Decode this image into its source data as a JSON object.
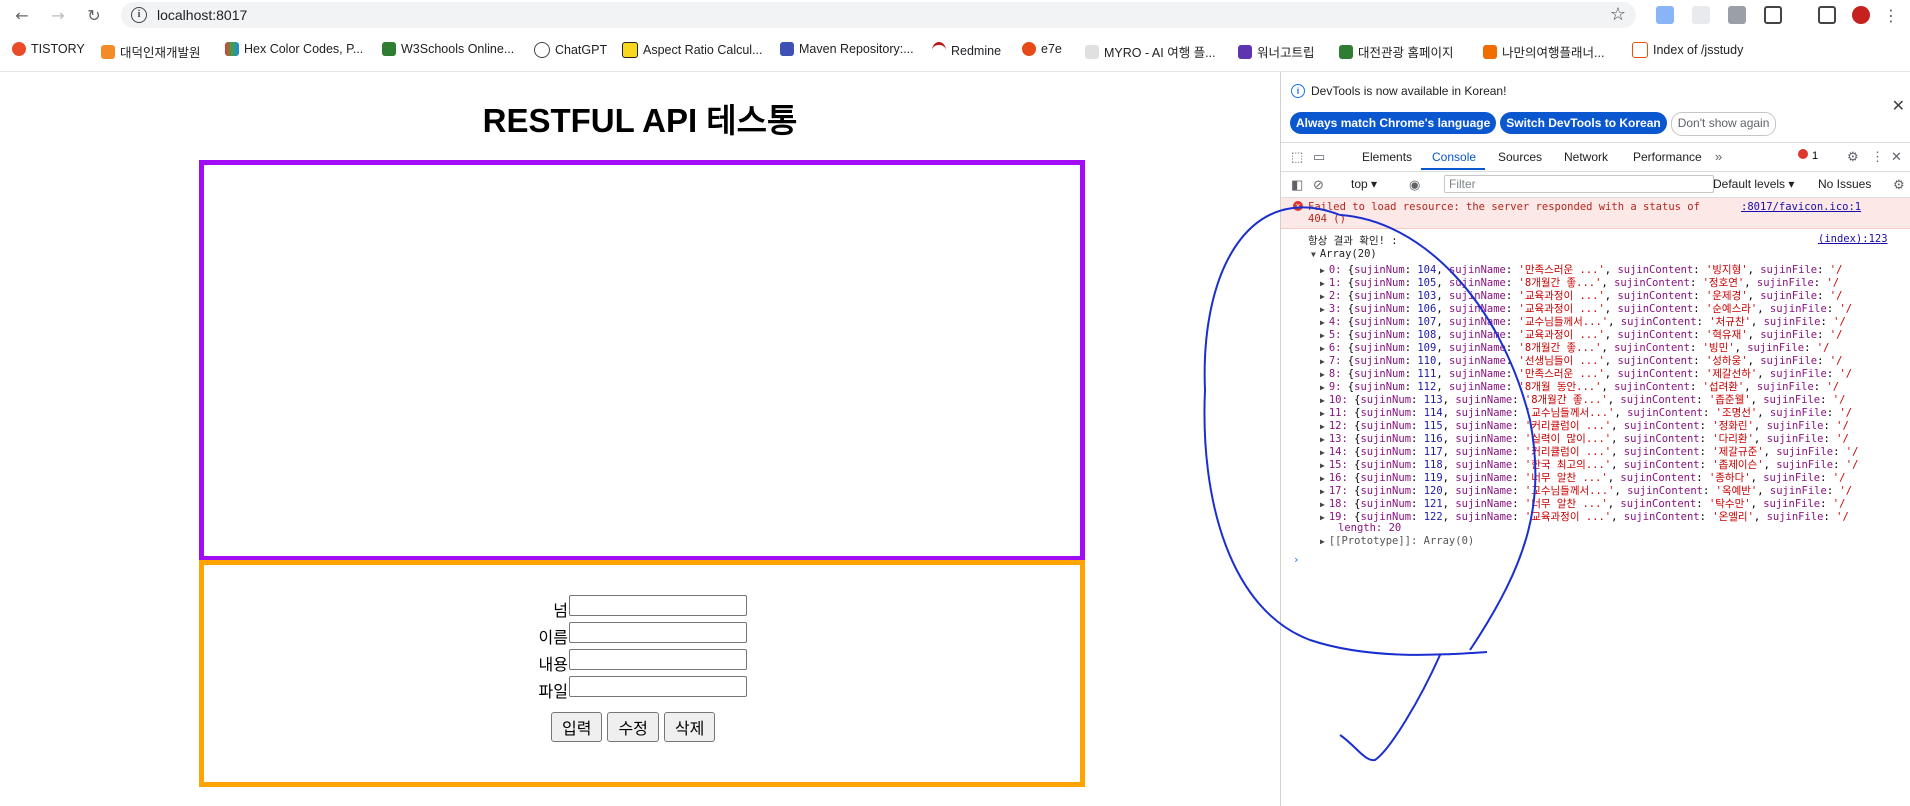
{
  "browser": {
    "url": "localhost:8017",
    "bookmarks": [
      "TISTORY",
      "대덕인재개발원",
      "Hex Color Codes, P...",
      "W3Schools Online...",
      "ChatGPT",
      "Aspect Ratio Calcul...",
      "Maven Repository:...",
      "Redmine",
      "e7e",
      "MYRO - AI 여행 플...",
      "워너고트립",
      "대전관광 홈페이지",
      "나만의여행플래너...",
      "Index of /jsstudy"
    ]
  },
  "page": {
    "title": "RESTFUL API 테스통",
    "form": {
      "fields": [
        {
          "label": "넘",
          "value": ""
        },
        {
          "label": "이름",
          "value": ""
        },
        {
          "label": "내용",
          "value": ""
        },
        {
          "label": "파일",
          "value": ""
        }
      ],
      "buttons": [
        "입력",
        "수정",
        "삭제"
      ]
    },
    "colors": {
      "top_box": "#a20cf4",
      "bottom_box": "#ffa400",
      "annotation": "#1a2fd0"
    }
  },
  "devtools": {
    "notice": "DevTools is now available in Korean!",
    "notice_buttons": [
      "Always match Chrome's language",
      "Switch DevTools to Korean",
      "Don't show again"
    ],
    "tabs": [
      "Elements",
      "Console",
      "Sources",
      "Network",
      "Performance"
    ],
    "error_count": "1",
    "context": "top",
    "filter_placeholder": "Filter",
    "levels": "Default levels",
    "issues": "No Issues",
    "error_text": "Failed to load resource: the server responded with a status of\n404 ()",
    "error_link": ":8017/favicon.ico:1",
    "log_label": "항상 결과 확인! :",
    "log_link": "(index):123",
    "array_header": "Array(20)",
    "rows": [
      [
        "0",
        "104",
        "만족스러운 ...",
        "빙지형"
      ],
      [
        "1",
        "105",
        "8개월간 좋...",
        "정호연"
      ],
      [
        "2",
        "103",
        "교육과정이 ...",
        "운제경"
      ],
      [
        "3",
        "106",
        "교육과정이 ...",
        "순예스라"
      ],
      [
        "4",
        "107",
        "교수님들께서...",
        "처규찬"
      ],
      [
        "5",
        "108",
        "교육과정이 ...",
        "혁유재"
      ],
      [
        "6",
        "109",
        "8개월간 좋...",
        "빙민"
      ],
      [
        "7",
        "110",
        "선생님들이 ...",
        "성하웅"
      ],
      [
        "8",
        "111",
        "만족스러운 ...",
        "제갈선하"
      ],
      [
        "9",
        "112",
        "8개월 동안...",
        "섭려환"
      ],
      [
        "10",
        "113",
        "8개월간 좋...",
        "좁준웰"
      ],
      [
        "11",
        "114",
        "교수님들께서...",
        "조명선"
      ],
      [
        "12",
        "115",
        "커리큘럼이 ...",
        "정화린"
      ],
      [
        "13",
        "116",
        "실력이 많이...",
        "다리환"
      ],
      [
        "14",
        "117",
        "커리큘럼이 ...",
        "제갈규준"
      ],
      [
        "15",
        "118",
        "한국 최고의...",
        "좁제이슨"
      ],
      [
        "16",
        "119",
        "너무 알찬 ...",
        "종하다"
      ],
      [
        "17",
        "120",
        "교수님들께서...",
        "옥예반"
      ],
      [
        "18",
        "121",
        "너무 알찬 ...",
        "탁수만"
      ],
      [
        "19",
        "122",
        "교육과정이 ...",
        "온엘리"
      ]
    ],
    "length_line": "length: 20",
    "prototype_line": "[[Prototype]]: Array(0)"
  }
}
